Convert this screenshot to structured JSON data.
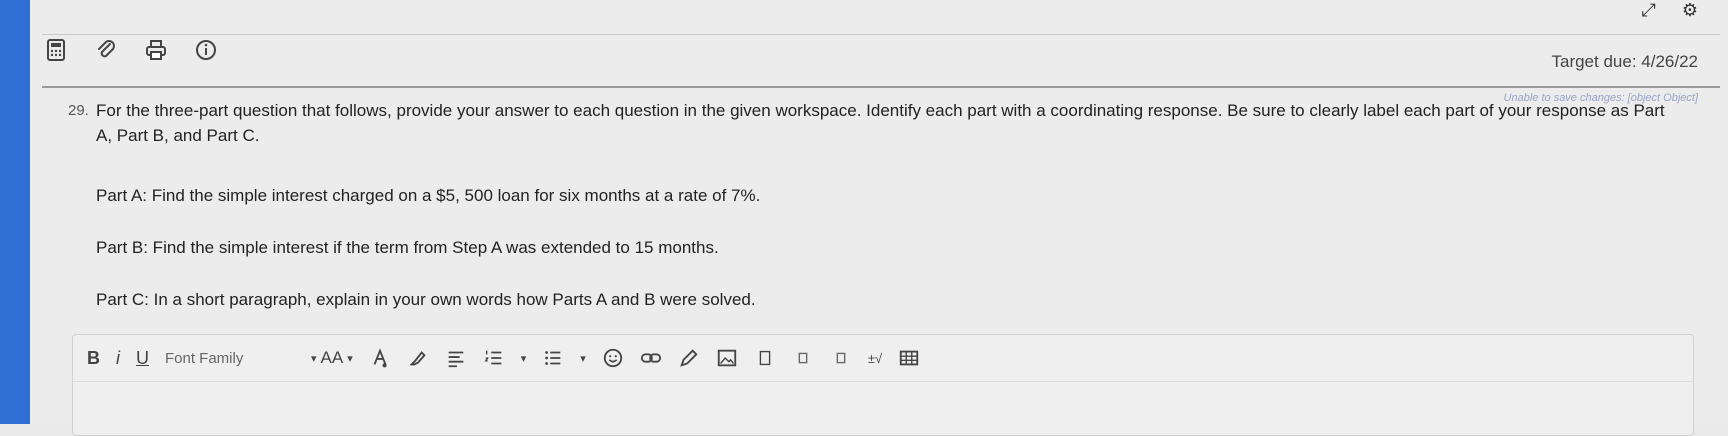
{
  "header": {
    "target_due": "Target due: 4/26/22",
    "save_status": "Unable to save changes: [object Object]"
  },
  "toolbar_icons": [
    "calculator-icon",
    "paperclip-icon",
    "print-icon",
    "info-icon"
  ],
  "corner_icons": [
    "expand-icon",
    "gear-icon"
  ],
  "question": {
    "number": "29.",
    "text": "For the three-part question that follows, provide your answer to each question in the given workspace. Identify each part with a coordinating response. Be sure to clearly label each part of your response as Part A, Part B, and Part C.",
    "part_a": "Part A: Find the simple interest charged on a $5, 500 loan for six months at a rate of 7%.",
    "part_b": "Part B: Find the simple interest if the term from Step A was extended to 15 months.",
    "part_c": "Part C: In a short paragraph, explain in your own words how Parts A and B were solved."
  },
  "editor": {
    "bold": "B",
    "italic": "i",
    "underline": "U",
    "font_family": "Font Family",
    "font_size": "AA",
    "math": "±√"
  }
}
